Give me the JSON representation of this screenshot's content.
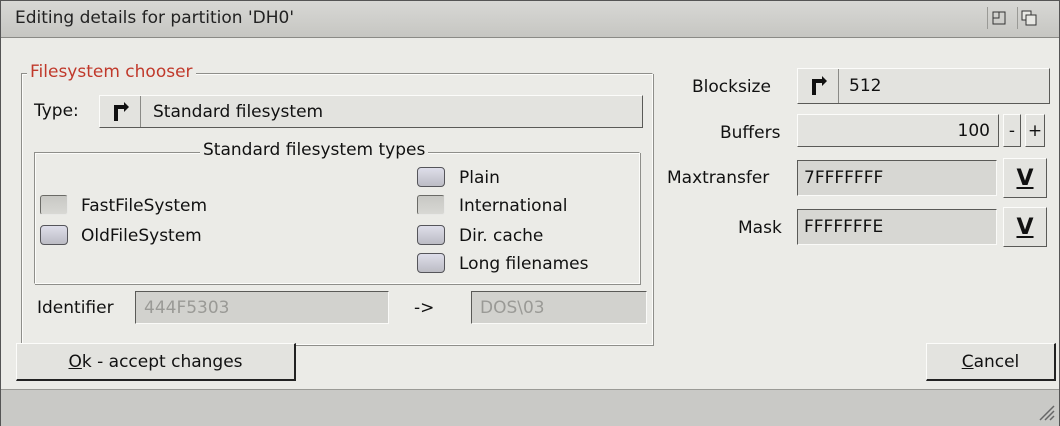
{
  "window": {
    "title": "Editing details for partition 'DH0'"
  },
  "filesystem_chooser": {
    "title": "Filesystem chooser",
    "type_label": "Type:",
    "type_value": "Standard filesystem"
  },
  "fs_types": {
    "title": "Standard filesystem types",
    "left": [
      {
        "label": "FastFileSystem",
        "checked": false
      },
      {
        "label": "OldFileSystem",
        "checked": true
      }
    ],
    "right": [
      {
        "label": "Plain",
        "checked": true
      },
      {
        "label": "International",
        "checked": false
      },
      {
        "label": "Dir. cache",
        "checked": true
      },
      {
        "label": "Long filenames",
        "checked": true
      }
    ]
  },
  "identifier": {
    "label": "Identifier",
    "value": "444F5303",
    "arrow": "->",
    "dos_value": "DOS\\03"
  },
  "blocksize": {
    "label": "Blocksize",
    "value": "512"
  },
  "buffers": {
    "label": "Buffers",
    "value": "100",
    "minus": "-",
    "plus": "+"
  },
  "maxtransfer": {
    "label": "Maxtransfer",
    "value": "7FFFFFFF",
    "popup": "V"
  },
  "mask": {
    "label": "Mask",
    "value": "FFFFFFFE",
    "popup": "V"
  },
  "buttons": {
    "ok_hotkey": "O",
    "ok_rest": "k - accept changes",
    "cancel_hotkey": "C",
    "cancel_rest": "ancel"
  },
  "colors": {
    "group_title_red": "#c0392b",
    "window_bg": "#ebebe7"
  }
}
